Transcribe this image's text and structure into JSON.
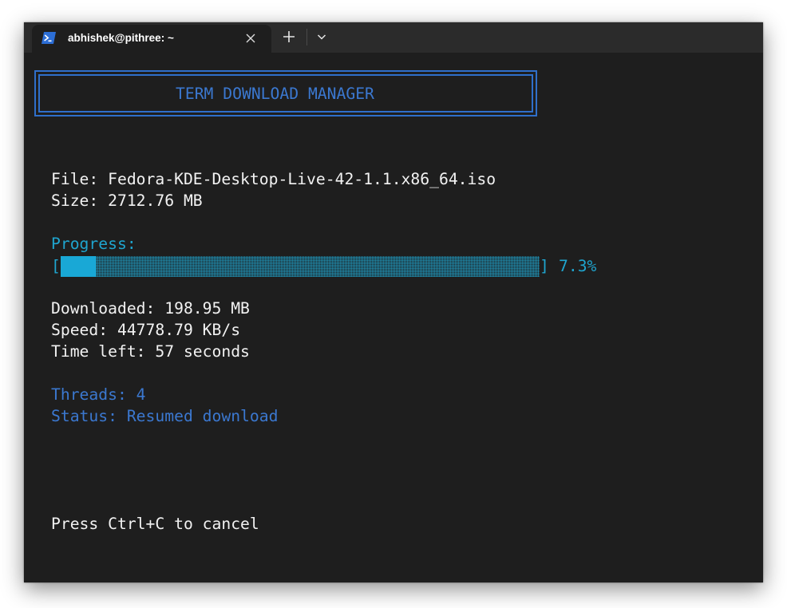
{
  "window": {
    "tab_title": "abhishek@pithree: ~",
    "tab_icon": "powershell-icon",
    "close_icon": "close-icon",
    "new_tab_icon": "plus-icon",
    "dropdown_icon": "chevron-down-icon"
  },
  "terminal": {
    "header": "TERM DOWNLOAD MANAGER",
    "file": "File: Fedora-KDE-Desktop-Live-42-1.1.x86_64.iso",
    "size": "Size: 2712.76 MB",
    "progress_label": "Progress:",
    "progress_open": "[",
    "progress_close": "]",
    "progress_fraction": 0.073,
    "progress_text": "7.3%",
    "downloaded": "Downloaded: 198.95 MB",
    "speed": "Speed: 44778.79 KB/s",
    "time_left": "Time left: 57 seconds",
    "threads": "Threads: 4",
    "status": "Status: Resumed download",
    "hint": "Press Ctrl+C to cancel"
  },
  "colors": {
    "background": "#1e1e1e",
    "titlebar": "#2b2b2b",
    "text": "#f2f2f2",
    "cyan": "#1fa5cf",
    "blue": "#3b78d0"
  }
}
